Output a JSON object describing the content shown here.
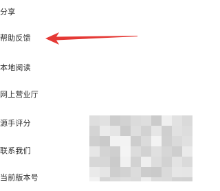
{
  "menu": {
    "items": [
      {
        "label": "分享"
      },
      {
        "label": "帮助反馈"
      },
      {
        "label": "本地阅读"
      },
      {
        "label": "网上营业厅"
      },
      {
        "label": "源手评分"
      },
      {
        "label": "联系我们"
      },
      {
        "label": "当前版本号"
      }
    ]
  },
  "annotation": {
    "arrow_color": "#e53935",
    "target_item_index": 1
  },
  "overlay": {
    "tone": "grey-mosaic"
  }
}
